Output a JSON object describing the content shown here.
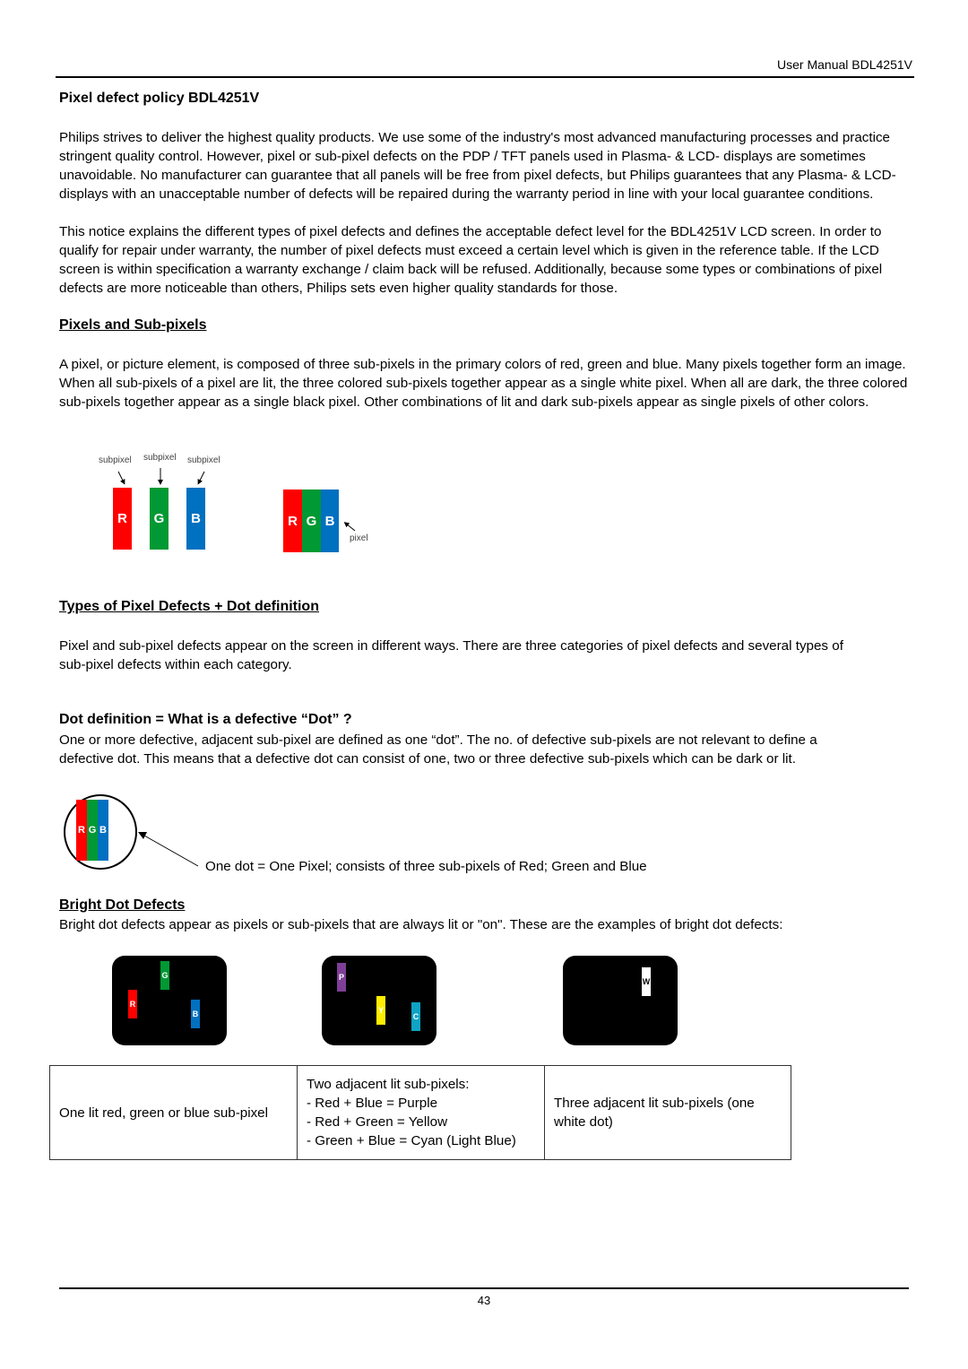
{
  "header": {
    "text": "User Manual BDL4251V"
  },
  "title": "Pixel defect policy BDL4251V",
  "intro_paragraph_1": "Philips strives to deliver the highest quality products. We use some of the industry's most advanced manufacturing processes and practice stringent quality control. However, pixel or sub-pixel defects on the PDP / TFT panels used in Plasma- & LCD- displays are sometimes unavoidable. No manufacturer can guarantee that all panels will be free from pixel defects, but Philips guarantees that any Plasma- & LCD- displays with an unacceptable number of defects will be repaired during the warranty period in line with your local guarantee conditions.",
  "intro_paragraph_2": "This notice explains the different types of pixel defects and defines the acceptable defect level for the BDL4251V LCD screen. In order to qualify for repair under warranty, the number of pixel defects must exceed a certain level which is given in the reference table. If the LCD screen is within specification a warranty exchange / claim back will be refused. Additionally, because some types or combinations of pixel defects are more noticeable than others, Philips sets even higher quality standards for those.",
  "pixels_section": {
    "heading": "Pixels and Sub-pixels",
    "body": "A pixel, or picture element, is composed of three sub-pixels in the primary colors of red, green and blue. Many pixels together form an image. When all sub-pixels of a pixel are lit, the three colored sub-pixels together appear as a single white pixel. When all are dark, the three colored sub-pixels together appear as a single black pixel. Other combinations of lit and dark sub-pixels appear as single pixels of other colors.",
    "figure": {
      "subpixel_label": "subpixel",
      "pixel_label": "pixel",
      "letters": [
        "R",
        "G",
        "B"
      ],
      "colors": {
        "red": "#ff0000",
        "green": "#009933",
        "blue": "#0070c0"
      }
    }
  },
  "types_section": {
    "heading": "Types of Pixel Defects + Dot definition",
    "body": "Pixel and sub-pixel defects appear on the screen in different ways. There are three categories of pixel defects and several types of sub-pixel defects within each category."
  },
  "dot_section": {
    "heading": "Dot definition = What is a defective “Dot” ?",
    "body": "One or more defective, adjacent sub-pixel are defined as one “dot”. The no. of defective sub-pixels are not relevant to define a defective dot. This means that a defective dot can consist of one, two or three defective sub-pixels which can be dark or lit.",
    "figure_caption": "One dot = One Pixel; consists of three sub-pixels of Red; Green and Blue",
    "letters": [
      "R",
      "G",
      "B"
    ]
  },
  "bright_section": {
    "heading": "Bright Dot Defects",
    "body": "Bright dot defects appear as pixels or sub-pixels that are always lit or \"on\". These are the examples of bright dot defects:",
    "panels": [
      {
        "dots": [
          {
            "letter": "G",
            "color": "#009933"
          },
          {
            "letter": "R",
            "color": "#ff0000"
          },
          {
            "letter": "B",
            "color": "#0070c0"
          }
        ]
      },
      {
        "dots": [
          {
            "letter": "P",
            "color": "#7f3f98"
          },
          {
            "letter": "Y",
            "color": "#ffee00"
          },
          {
            "letter": "C",
            "color": "#0fa3c4"
          }
        ]
      },
      {
        "dots": [
          {
            "letter": "W",
            "color": "#ffffff"
          }
        ]
      }
    ],
    "table": {
      "col1": "One lit red, green or blue sub-pixel",
      "col2_lines": [
        "Two adjacent lit sub-pixels:",
        "- Red + Blue = Purple",
        "- Red + Green = Yellow",
        "- Green + Blue = Cyan (Light Blue)"
      ],
      "col3": "Three adjacent lit sub-pixels (one white dot)"
    }
  },
  "footer": {
    "page_number": "43"
  }
}
